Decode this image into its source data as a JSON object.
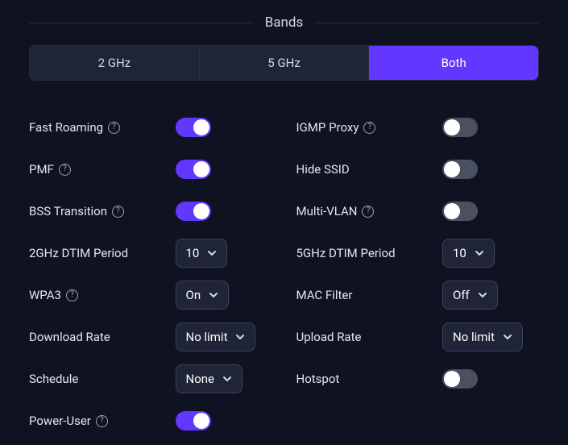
{
  "section": {
    "title": "Bands"
  },
  "tabs": {
    "items": [
      "2 GHz",
      "5 GHz",
      "Both"
    ],
    "active_index": 2
  },
  "settings": {
    "left": [
      {
        "label": "Fast Roaming",
        "help": true,
        "type": "toggle",
        "on": true,
        "name": "fast-roaming"
      },
      {
        "label": "PMF",
        "help": true,
        "type": "toggle",
        "on": true,
        "name": "pmf"
      },
      {
        "label": "BSS Transition",
        "help": true,
        "type": "toggle",
        "on": true,
        "name": "bss-transition"
      },
      {
        "label": "2GHz DTIM Period",
        "help": false,
        "type": "dropdown",
        "value": "10",
        "name": "2ghz-dtim"
      },
      {
        "label": "WPA3",
        "help": true,
        "type": "dropdown",
        "value": "On",
        "name": "wpa3"
      },
      {
        "label": "Download Rate",
        "help": false,
        "type": "dropdown",
        "value": "No limit",
        "wide": true,
        "name": "download-rate"
      },
      {
        "label": "Schedule",
        "help": false,
        "type": "dropdown",
        "value": "None",
        "name": "schedule"
      },
      {
        "label": "Power-User",
        "help": true,
        "type": "toggle",
        "on": true,
        "name": "power-user"
      }
    ],
    "right": [
      {
        "label": "IGMP Proxy",
        "help": true,
        "type": "toggle",
        "on": false,
        "name": "igmp-proxy"
      },
      {
        "label": "Hide SSID",
        "help": false,
        "type": "toggle",
        "on": false,
        "name": "hide-ssid"
      },
      {
        "label": "Multi-VLAN",
        "help": true,
        "type": "toggle",
        "on": false,
        "name": "multi-vlan"
      },
      {
        "label": "5GHz DTIM Period",
        "help": false,
        "type": "dropdown",
        "value": "10",
        "name": "5ghz-dtim"
      },
      {
        "label": "MAC Filter",
        "help": false,
        "type": "dropdown",
        "value": "Off",
        "name": "mac-filter"
      },
      {
        "label": "Upload Rate",
        "help": false,
        "type": "dropdown",
        "value": "No limit",
        "wide": true,
        "name": "upload-rate"
      },
      {
        "label": "Hotspot",
        "help": false,
        "type": "toggle",
        "on": false,
        "name": "hotspot"
      }
    ]
  }
}
